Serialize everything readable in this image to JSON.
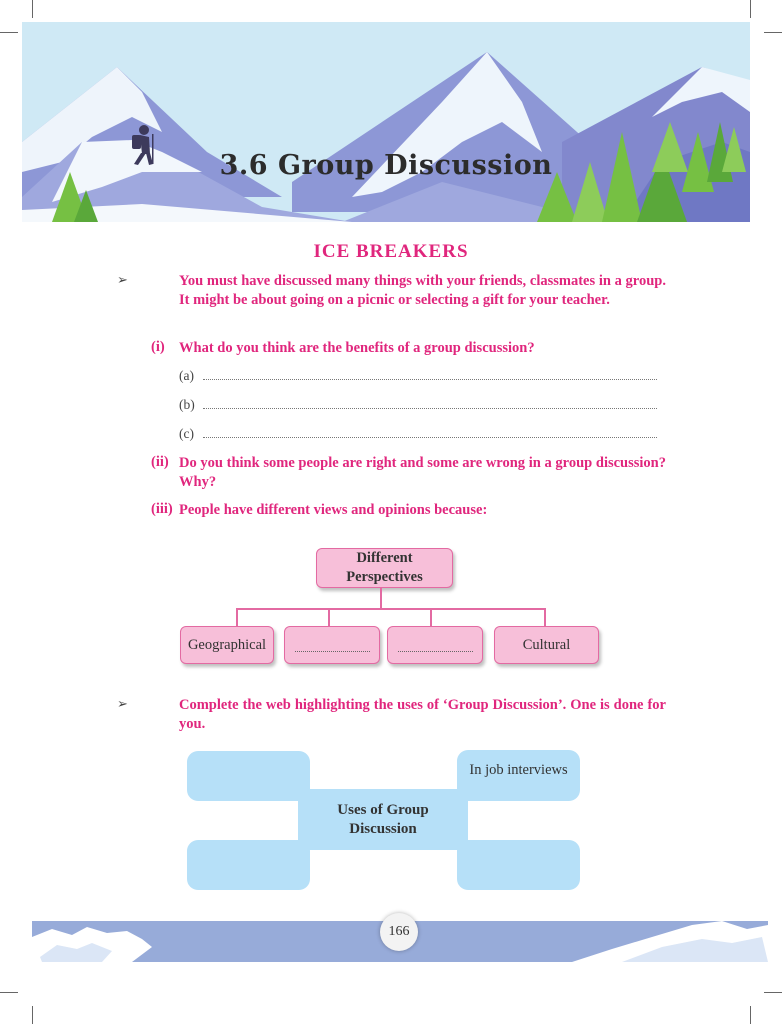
{
  "banner": {
    "title": "3.6 Group Discussion",
    "sky_color": "#cfe9f5",
    "mountain_color": "#8d97d6"
  },
  "section": {
    "heading": "ICE BREAKERS",
    "bullet": "➢",
    "intro": "You must have discussed many things with your friends, classmates in a group. It might be about going on a picnic or selecting a gift for your teacher."
  },
  "questions": [
    {
      "num": "(i)",
      "text": "What do you think are the benefits of a group discussion?",
      "answers": [
        "(a)",
        "(b)",
        "(c)"
      ]
    },
    {
      "num": "(ii)",
      "text": "Do you think some people are right and some are wrong in a group discussion? Why?"
    },
    {
      "num": "(iii)",
      "text": "People have different views and opinions because:"
    }
  ],
  "perspectives": {
    "root": "Different Perspectives",
    "children": [
      "Geographical",
      "",
      "",
      "Cultural"
    ]
  },
  "web_task": {
    "text": "Complete the web highlighting the uses of ‘Group Discussion’. One is done for you.",
    "center": "Uses of Group Discussion",
    "top_right": "In job interviews"
  },
  "footer": {
    "page_number": "166"
  },
  "colors": {
    "accent_pink": "#e0267d",
    "box_pink": "#f7bfd9",
    "box_blue": "#b6e0f8",
    "footer_band": "#97abd9"
  }
}
